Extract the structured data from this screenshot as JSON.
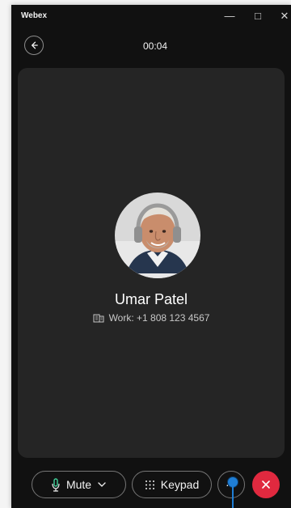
{
  "window": {
    "title": "Webex",
    "controls": [
      "minimize-icon",
      "maximize-icon",
      "close-icon"
    ]
  },
  "call": {
    "back_icon": "arrow-left-icon",
    "timer": "00:04"
  },
  "participant": {
    "avatar": "user-avatar-photo",
    "name": "Umar Patel",
    "work_icon": "building-icon",
    "work_line": "Work: +1 808 123 4567"
  },
  "controls": {
    "mute_label": "Mute",
    "mute_icon": "microphone-icon",
    "dropdown_icon": "chevron-down-icon",
    "keypad_label": "Keypad",
    "keypad_icon": "dialpad-icon",
    "more_label": "···",
    "more_icon": "more-icon",
    "hangup_icon": "hangup-close-icon"
  },
  "colors": {
    "background": "#111111",
    "stage": "#252525",
    "hangup": "#e0293f",
    "accent": "#1f7ed5"
  }
}
